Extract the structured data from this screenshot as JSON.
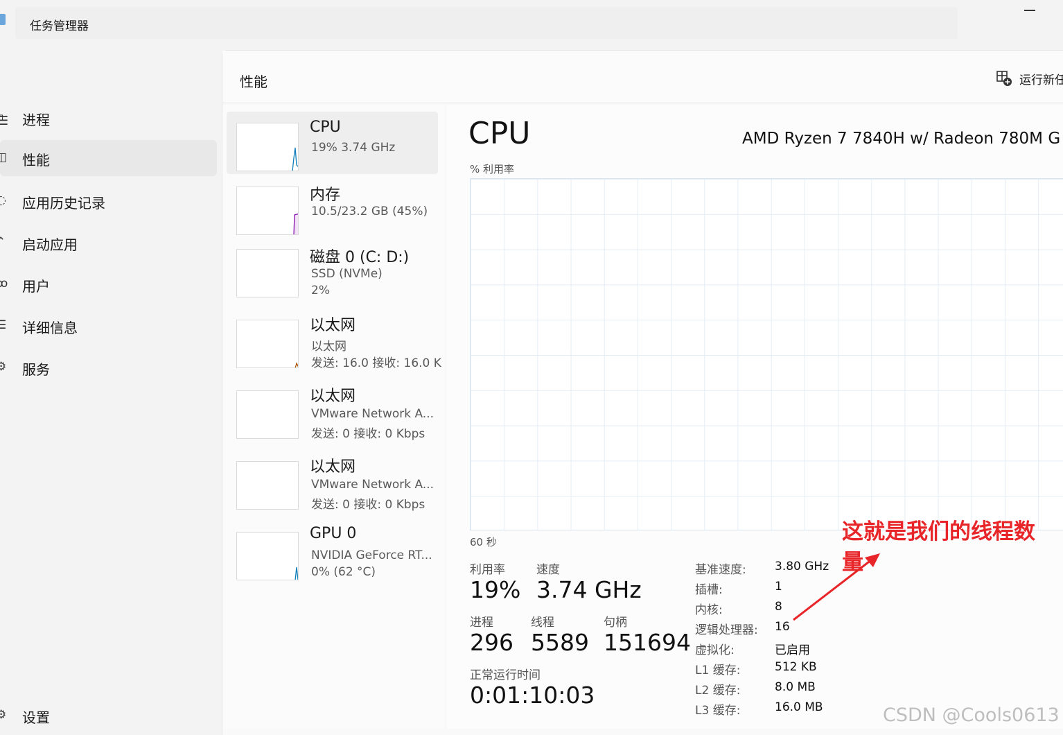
{
  "window": {
    "title": "任务管理器"
  },
  "sidebar": {
    "items": [
      {
        "label": "进程",
        "icon": "process-grid-icon"
      },
      {
        "label": "性能",
        "icon": "performance-chart-icon",
        "active": true
      },
      {
        "label": "应用历史记录",
        "icon": "history-clock-icon"
      },
      {
        "label": "启动应用",
        "icon": "startup-rocket-icon"
      },
      {
        "label": "用户",
        "icon": "users-icon"
      },
      {
        "label": "详细信息",
        "icon": "details-list-icon"
      },
      {
        "label": "服务",
        "icon": "services-gear-icon"
      }
    ],
    "settings_label": "设置"
  },
  "header": {
    "title": "性能",
    "run_task_label": "运行新任"
  },
  "devices": [
    {
      "name": "CPU",
      "sub1": "19%  3.74 GHz",
      "sub2": "",
      "graph_color": "#117dbb"
    },
    {
      "name": "内存",
      "sub1": "10.5/23.2 GB (45%)",
      "sub2": "",
      "graph_color": "#8b12ae"
    },
    {
      "name": "磁盘 0 (C: D:)",
      "sub1": "SSD (NVMe)",
      "sub2": "2%",
      "graph_color": "#4da60c"
    },
    {
      "name": "以太网",
      "sub1": "以太网",
      "sub2": "发送: 16.0 接收: 16.0 K",
      "graph_color": "#a74f01"
    },
    {
      "name": "以太网",
      "sub1": "VMware Network A...",
      "sub2": "发送: 0 接收: 0 Kbps",
      "graph_color": "#a74f01"
    },
    {
      "name": "以太网",
      "sub1": "VMware Network A...",
      "sub2": "发送: 0 接收: 0 Kbps",
      "graph_color": "#a74f01"
    },
    {
      "name": "GPU 0",
      "sub1": "NVIDIA GeForce RT...",
      "sub2": "0%  (62 °C)",
      "graph_color": "#117dbb"
    }
  ],
  "cpu": {
    "title": "CPU",
    "model": "AMD Ryzen 7 7840H w/ Radeon 780M G",
    "graph_ylabel": "% 利用率",
    "graph_xlabel": "60 秒",
    "stats": {
      "utilization_label": "利用率",
      "utilization": "19%",
      "speed_label": "速度",
      "speed": "3.74 GHz",
      "processes_label": "进程",
      "processes": "296",
      "threads_label": "线程",
      "threads": "5589",
      "handles_label": "句柄",
      "handles": "151694",
      "uptime_label": "正常运行时间",
      "uptime": "0:01:10:03"
    },
    "specs": [
      {
        "key": "基准速度:",
        "value": "3.80 GHz"
      },
      {
        "key": "插槽:",
        "value": "1"
      },
      {
        "key": "内核:",
        "value": "8"
      },
      {
        "key": "逻辑处理器:",
        "value": "16"
      },
      {
        "key": "虚拟化:",
        "value": "已启用"
      },
      {
        "key": "L1 缓存:",
        "value": "512 KB"
      },
      {
        "key": "L2 缓存:",
        "value": "8.0 MB"
      },
      {
        "key": "L3 缓存:",
        "value": "16.0 MB"
      }
    ]
  },
  "annotation": {
    "text": "这就是我们的线程数量",
    "color": "#e8262a"
  },
  "watermark": "CSDN @Cools0613"
}
